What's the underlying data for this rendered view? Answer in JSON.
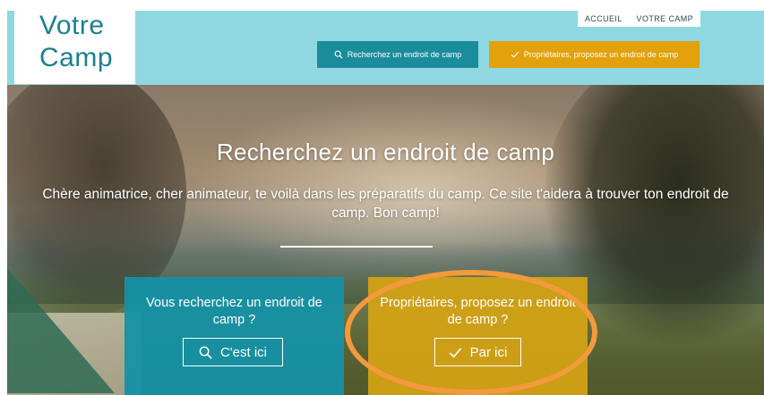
{
  "logo": {
    "line1": "Votre",
    "line2": "Camp"
  },
  "topnav": {
    "home": "ACCUEIL",
    "your_camp": "VOTRE CAMP"
  },
  "header_buttons": {
    "search_label": "Recherchez un endroit de camp",
    "owner_label": "Propriétaires, proposez un endroit de camp"
  },
  "hero": {
    "title": "Recherchez un endroit de camp",
    "subtitle": "Chère animatrice, cher animateur, te voilà dans les préparatifs du camp. Ce site t'aidera à trouver ton endroit de camp. Bon camp!"
  },
  "cards": {
    "search": {
      "text": "Vous recherchez un endroit de camp ?",
      "button": "C'est ici"
    },
    "owner": {
      "text": "Propriétaires, proposez un endroit de camp ?",
      "button": "Par ici"
    }
  },
  "colors": {
    "header_bg": "#8fd8e2",
    "logo_text": "#1a7f92",
    "teal": "#1a8c9c",
    "amber": "#e3a10b",
    "highlight": "#f39a3c"
  },
  "icons": {
    "search": "search-icon",
    "check": "check-icon"
  }
}
